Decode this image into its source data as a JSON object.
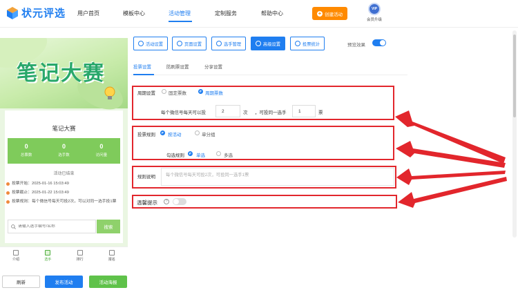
{
  "brand": {
    "name": "状元评选"
  },
  "nav": {
    "items": [
      "用户首页",
      "模板中心",
      "活动管理",
      "定制服务",
      "帮助中心"
    ],
    "create_label": "创建活动",
    "vip_badge": "VIP",
    "vip_label": "会员升级"
  },
  "preview": {
    "banner_title": "笔记大赛",
    "card_title": "笔记大赛",
    "stats": [
      {
        "value": "0",
        "label": "总票数"
      },
      {
        "value": "0",
        "label": "选手数"
      },
      {
        "value": "0",
        "label": "访问量"
      }
    ],
    "status": "活动已结束",
    "info": [
      "投票开始：2025-01-16 15:03:49",
      "投票截止：2025-01-22 15:03:49",
      "投票规则：每个微信号每天可投2次，可以对同一选手投1票"
    ],
    "search_placeholder": "请输入选手编号/名称",
    "search_button": "搜索",
    "tabs": [
      "介绍",
      "选手",
      "排行",
      "报名"
    ],
    "buttons": {
      "refresh": "刷新",
      "publish": "发布活动",
      "poster": "活动海报"
    }
  },
  "toolbar": {
    "buttons": [
      "活动设置",
      "页面设置",
      "选手管理",
      "高级设置",
      "投票统计"
    ],
    "active": "高级设置",
    "preview_label": "预览效果",
    "preview_on": true
  },
  "subtabs": {
    "items": [
      "投票设置",
      "防刷票设置",
      "分享设置"
    ],
    "active": "投票设置"
  },
  "cycle": {
    "label": "周期设置",
    "options": [
      "固定票数",
      "周期票数"
    ],
    "selected": "周期票数",
    "text_prefix": "每个微信号每天可以投",
    "times_value": "2",
    "times_unit": "次",
    "text_middle": "，可投同一选手",
    "votes_value": "1",
    "votes_unit": "票"
  },
  "rule": {
    "label": "投票规则",
    "options": [
      "按活动",
      "单分组"
    ],
    "selected": "按活动",
    "check_label": "勾选规则",
    "check_options": [
      "单选",
      "多选"
    ],
    "check_selected": "单选"
  },
  "desc": {
    "label": "规则说明",
    "placeholder": "每个微信号每天可投2次，可投同一选手1票"
  },
  "tip": {
    "label": "温馨提示",
    "help": "?",
    "enabled": false
  },
  "colors": {
    "primary": "#1f7ef0",
    "accent": "#ff8a00",
    "highlight": "#e2262c",
    "green": "#5fc24a"
  }
}
